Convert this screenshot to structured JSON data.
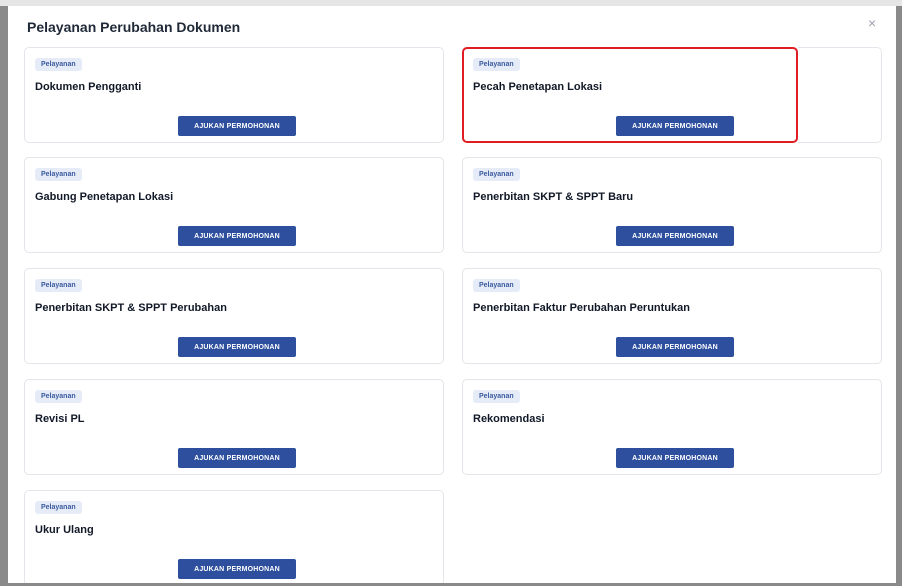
{
  "modal": {
    "title": "Pelayanan Perubahan Dokumen",
    "close_icon": "×"
  },
  "cards": [
    {
      "badge": "Pelayanan",
      "title": "Dokumen Pengganti",
      "button": "AJUKAN PERMOHONAN"
    },
    {
      "badge": "Pelayanan",
      "title": "Pecah Penetapan Lokasi",
      "button": "AJUKAN PERMOHONAN",
      "highlighted": true
    },
    {
      "badge": "Pelayanan",
      "title": "Gabung Penetapan Lokasi",
      "button": "AJUKAN PERMOHONAN"
    },
    {
      "badge": "Pelayanan",
      "title": "Penerbitan SKPT & SPPT Baru",
      "button": "AJUKAN PERMOHONAN"
    },
    {
      "badge": "Pelayanan",
      "title": "Penerbitan SKPT & SPPT Perubahan",
      "button": "AJUKAN PERMOHONAN"
    },
    {
      "badge": "Pelayanan",
      "title": "Penerbitan Faktur Perubahan Peruntukan",
      "button": "AJUKAN PERMOHONAN"
    },
    {
      "badge": "Pelayanan",
      "title": "Revisi PL",
      "button": "AJUKAN PERMOHONAN"
    },
    {
      "badge": "Pelayanan",
      "title": "Rekomendasi",
      "button": "AJUKAN PERMOHONAN"
    },
    {
      "badge": "Pelayanan",
      "title": "Ukur Ulang",
      "button": "AJUKAN PERMOHONAN"
    }
  ],
  "colors": {
    "primary_button": "#2d4f9e",
    "badge_bg": "#e6ecf7",
    "badge_text": "#3b5aa0",
    "highlight_border": "#e11d24"
  }
}
